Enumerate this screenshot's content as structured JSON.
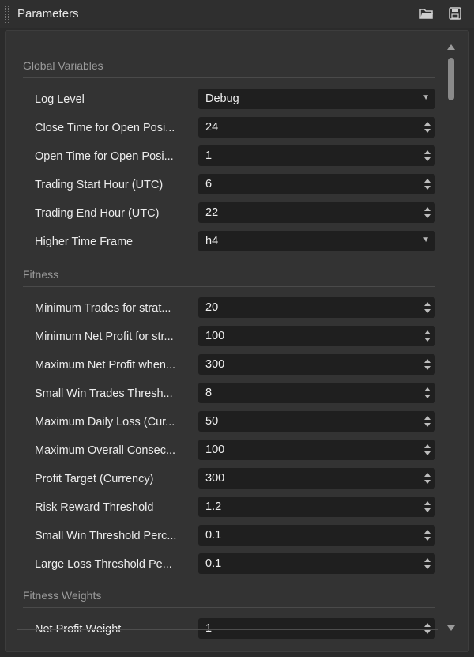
{
  "window": {
    "title": "Parameters"
  },
  "sections": {
    "global": {
      "label": "Global Variables"
    },
    "fitness": {
      "label": "Fitness"
    },
    "weights": {
      "label": "Fitness Weights"
    }
  },
  "params": [
    {
      "label": "Log Level",
      "value": "Debug",
      "control": "dropdown"
    },
    {
      "label": "Close Time for Open Posi...",
      "value": "24",
      "control": "spinner"
    },
    {
      "label": "Open Time for Open Posi...",
      "value": "1",
      "control": "spinner"
    },
    {
      "label": "Trading Start Hour (UTC)",
      "value": "6",
      "control": "spinner"
    },
    {
      "label": "Trading End Hour (UTC)",
      "value": "22",
      "control": "spinner"
    },
    {
      "label": "Higher Time Frame",
      "value": "h4",
      "control": "dropdown"
    },
    {
      "label": "Minimum Trades for strat...",
      "value": "20",
      "control": "spinner"
    },
    {
      "label": "Minimum Net Profit for str...",
      "value": "100",
      "control": "spinner"
    },
    {
      "label": "Maximum Net Profit when...",
      "value": "300",
      "control": "spinner"
    },
    {
      "label": "Small Win Trades Thresh...",
      "value": "8",
      "control": "spinner"
    },
    {
      "label": "Maximum Daily Loss (Cur...",
      "value": "50",
      "control": "spinner"
    },
    {
      "label": "Maximum Overall Consec...",
      "value": "100",
      "control": "spinner"
    },
    {
      "label": "Profit Target (Currency)",
      "value": "300",
      "control": "spinner"
    },
    {
      "label": "Risk Reward Threshold",
      "value": "1.2",
      "control": "spinner"
    },
    {
      "label": "Small Win Threshold Perc...",
      "value": "0.1",
      "control": "spinner"
    },
    {
      "label": "Large Loss Threshold Pe...",
      "value": "0.1",
      "control": "spinner"
    },
    {
      "label": "Net Profit Weight",
      "value": "1",
      "control": "spinner"
    }
  ],
  "icons": {
    "open": "folder-open-icon",
    "save": "save-icon",
    "dropdown": "dropdown-arrow-icon",
    "spinner": "spinner-icon",
    "scroll_up": "scroll-up-arrow-icon",
    "scroll_down": "scroll-down-arrow-icon"
  }
}
